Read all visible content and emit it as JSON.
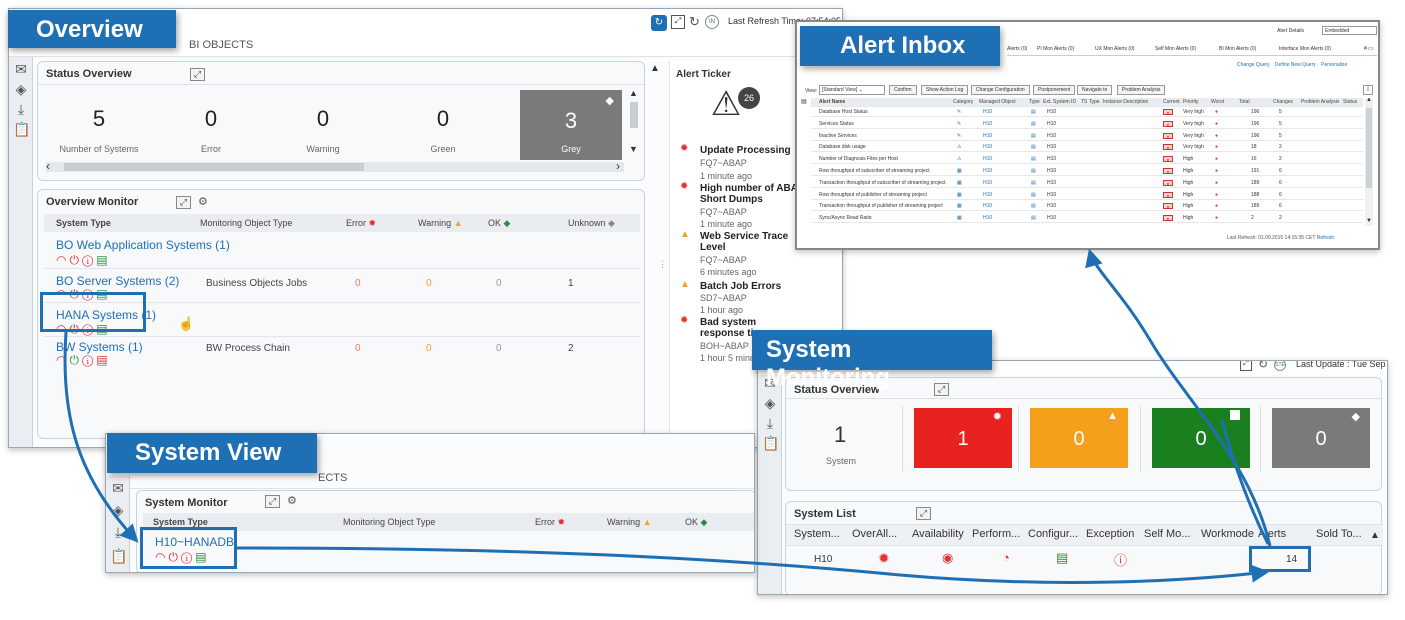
{
  "callouts": {
    "overview": "Overview",
    "alert_inbox": "Alert Inbox",
    "system_monitoring": "System Monitoring",
    "system_view": "System View"
  },
  "overview": {
    "tab_label": "BI OBJECTS",
    "last_refresh": "Last Refresh Time: 07:54:05",
    "status_overview": {
      "title": "Status Overview",
      "tiles": [
        {
          "value": "5",
          "label": "Number of Systems"
        },
        {
          "value": "0",
          "label": "Error"
        },
        {
          "value": "0",
          "label": "Warning"
        },
        {
          "value": "0",
          "label": "Green"
        },
        {
          "value": "3",
          "label": "Grey"
        }
      ]
    },
    "monitor": {
      "title": "Overview Monitor",
      "columns": [
        "System Type",
        "Monitoring Object Type",
        "Error",
        "Warning",
        "OK",
        "Unknown"
      ],
      "rows": [
        {
          "system": "BO Web Application Systems (1)",
          "object": "",
          "error": "",
          "warning": "",
          "ok": "",
          "unknown": ""
        },
        {
          "system": "BO Server Systems (2)",
          "object": "Business Objects Jobs",
          "error": "0",
          "warning": "0",
          "ok": "0",
          "unknown": "1"
        },
        {
          "system": "HANA Systems (1)",
          "object": "",
          "error": "",
          "warning": "",
          "ok": "",
          "unknown": ""
        },
        {
          "system": "BW Systems (1)",
          "object": "BW Process Chain",
          "error": "0",
          "warning": "0",
          "ok": "0",
          "unknown": "2"
        }
      ]
    },
    "ticker": {
      "title": "Alert Ticker",
      "count": "26",
      "items": [
        {
          "title": "Update Processing",
          "system": "FQ7~ABAP",
          "time": "1 minute ago",
          "severity": "red"
        },
        {
          "title": "High number of ABAP Short Dumps",
          "system": "FQ7~ABAP",
          "time": "1 minute ago",
          "severity": "red"
        },
        {
          "title": "Web Service Trace Level",
          "system": "FQ7~ABAP",
          "time": "6 minutes ago",
          "severity": "yellow"
        },
        {
          "title": "Batch Job Errors",
          "system": "SD7~ABAP",
          "time": "1 hour ago",
          "severity": "yellow"
        },
        {
          "title": "Bad system response tim",
          "system": "BOH~ABAP",
          "time": "1 hour 5 minut",
          "severity": "red"
        }
      ]
    }
  },
  "alert_inbox": {
    "tabs": [
      "Alerts (0)",
      "PI Mon Alerts (0)",
      "UX Mon Alerts (0)",
      "Self Mon Alerts (0)",
      "BI Mon Alerts (0)",
      "Interface Mon Alerts (0)"
    ],
    "alert_details_label": "Alert Details",
    "alert_details_value": "Embedded",
    "links": [
      "Change Query",
      "Define New Query",
      "Personalize"
    ],
    "view_label": "View:",
    "view_value": "[Standard View]",
    "toolbar": [
      "Confirm",
      "Show Action Log",
      "Change Configuration",
      "Postponement",
      "Navigate to",
      "Problem Analysis"
    ],
    "columns": [
      "Alert Name",
      "Category",
      "Managed Object",
      "Type",
      "Ext. System ID",
      "TS Type",
      "Instance Description",
      "Current",
      "Priority",
      "Worst",
      "Total",
      "Changes",
      "Problem Analysis",
      "Status"
    ],
    "rows": [
      {
        "name": "Database Host Status",
        "obj": "H10",
        "ext": "H10",
        "priority": "Very high",
        "total": "196",
        "changes": "5"
      },
      {
        "name": "Services Status",
        "obj": "H10",
        "ext": "H10",
        "priority": "Very high",
        "total": "196",
        "changes": "5"
      },
      {
        "name": "Inactive Services",
        "obj": "H10",
        "ext": "H10",
        "priority": "Very high",
        "total": "196",
        "changes": "5"
      },
      {
        "name": "Database disk usage",
        "obj": "H10",
        "ext": "H10",
        "priority": "Very high",
        "total": "18",
        "changes": "2"
      },
      {
        "name": "Number of Diagnosis Files per Host",
        "obj": "H10",
        "ext": "H10",
        "priority": "High",
        "total": "16",
        "changes": "2"
      },
      {
        "name": "Row throughput of subscriber of streaming project",
        "obj": "H10",
        "ext": "H10",
        "priority": "High",
        "total": "191",
        "changes": "6"
      },
      {
        "name": "Transaction throughput of subscriber of streaming project",
        "obj": "H10",
        "ext": "H10",
        "priority": "High",
        "total": "189",
        "changes": "6"
      },
      {
        "name": "Row throughput of publisher of streaming project",
        "obj": "H10",
        "ext": "H10",
        "priority": "High",
        "total": "188",
        "changes": "6"
      },
      {
        "name": "Transaction throughput of publisher of streaming project",
        "obj": "H10",
        "ext": "H10",
        "priority": "High",
        "total": "189",
        "changes": "6"
      },
      {
        "name": "Sync/Async Read Ratio",
        "obj": "H10",
        "ext": "H10",
        "priority": "High",
        "total": "2",
        "changes": "2"
      }
    ],
    "last_refresh": "Last Refresh: 01.09.2015 14:15:35 CET",
    "refresh_link": "Refresh"
  },
  "system_monitoring": {
    "last_update": "Last Update : Tue Sep",
    "status_overview": {
      "title": "Status Overview",
      "count": "1",
      "count_label": "System",
      "tiles": [
        {
          "value": "1",
          "color": "#e8231f"
        },
        {
          "value": "0",
          "color": "#f5a01a"
        },
        {
          "value": "0",
          "color": "#1a7f1e"
        },
        {
          "value": "0",
          "color": "#7a7a7a"
        }
      ]
    },
    "system_list": {
      "title": "System List",
      "columns": [
        "System...",
        "OverAll...",
        "Availability",
        "Perform...",
        "Configur...",
        "Exception",
        "Self Mo...",
        "Workmode",
        "Alerts",
        "Sold To..."
      ],
      "row": {
        "system": "H10",
        "alerts": "14"
      }
    }
  },
  "system_view": {
    "tab_label": "ECTS",
    "monitor_title": "System Monitor",
    "columns": [
      "System Type",
      "Monitoring Object Type",
      "Error",
      "Warning",
      "OK"
    ],
    "row": {
      "system": "H10~HANADB"
    }
  },
  "colors": {
    "accent": "#1f6fb5",
    "error": "#e23333",
    "warning": "#f0a030",
    "ok": "#2e8b3e"
  }
}
